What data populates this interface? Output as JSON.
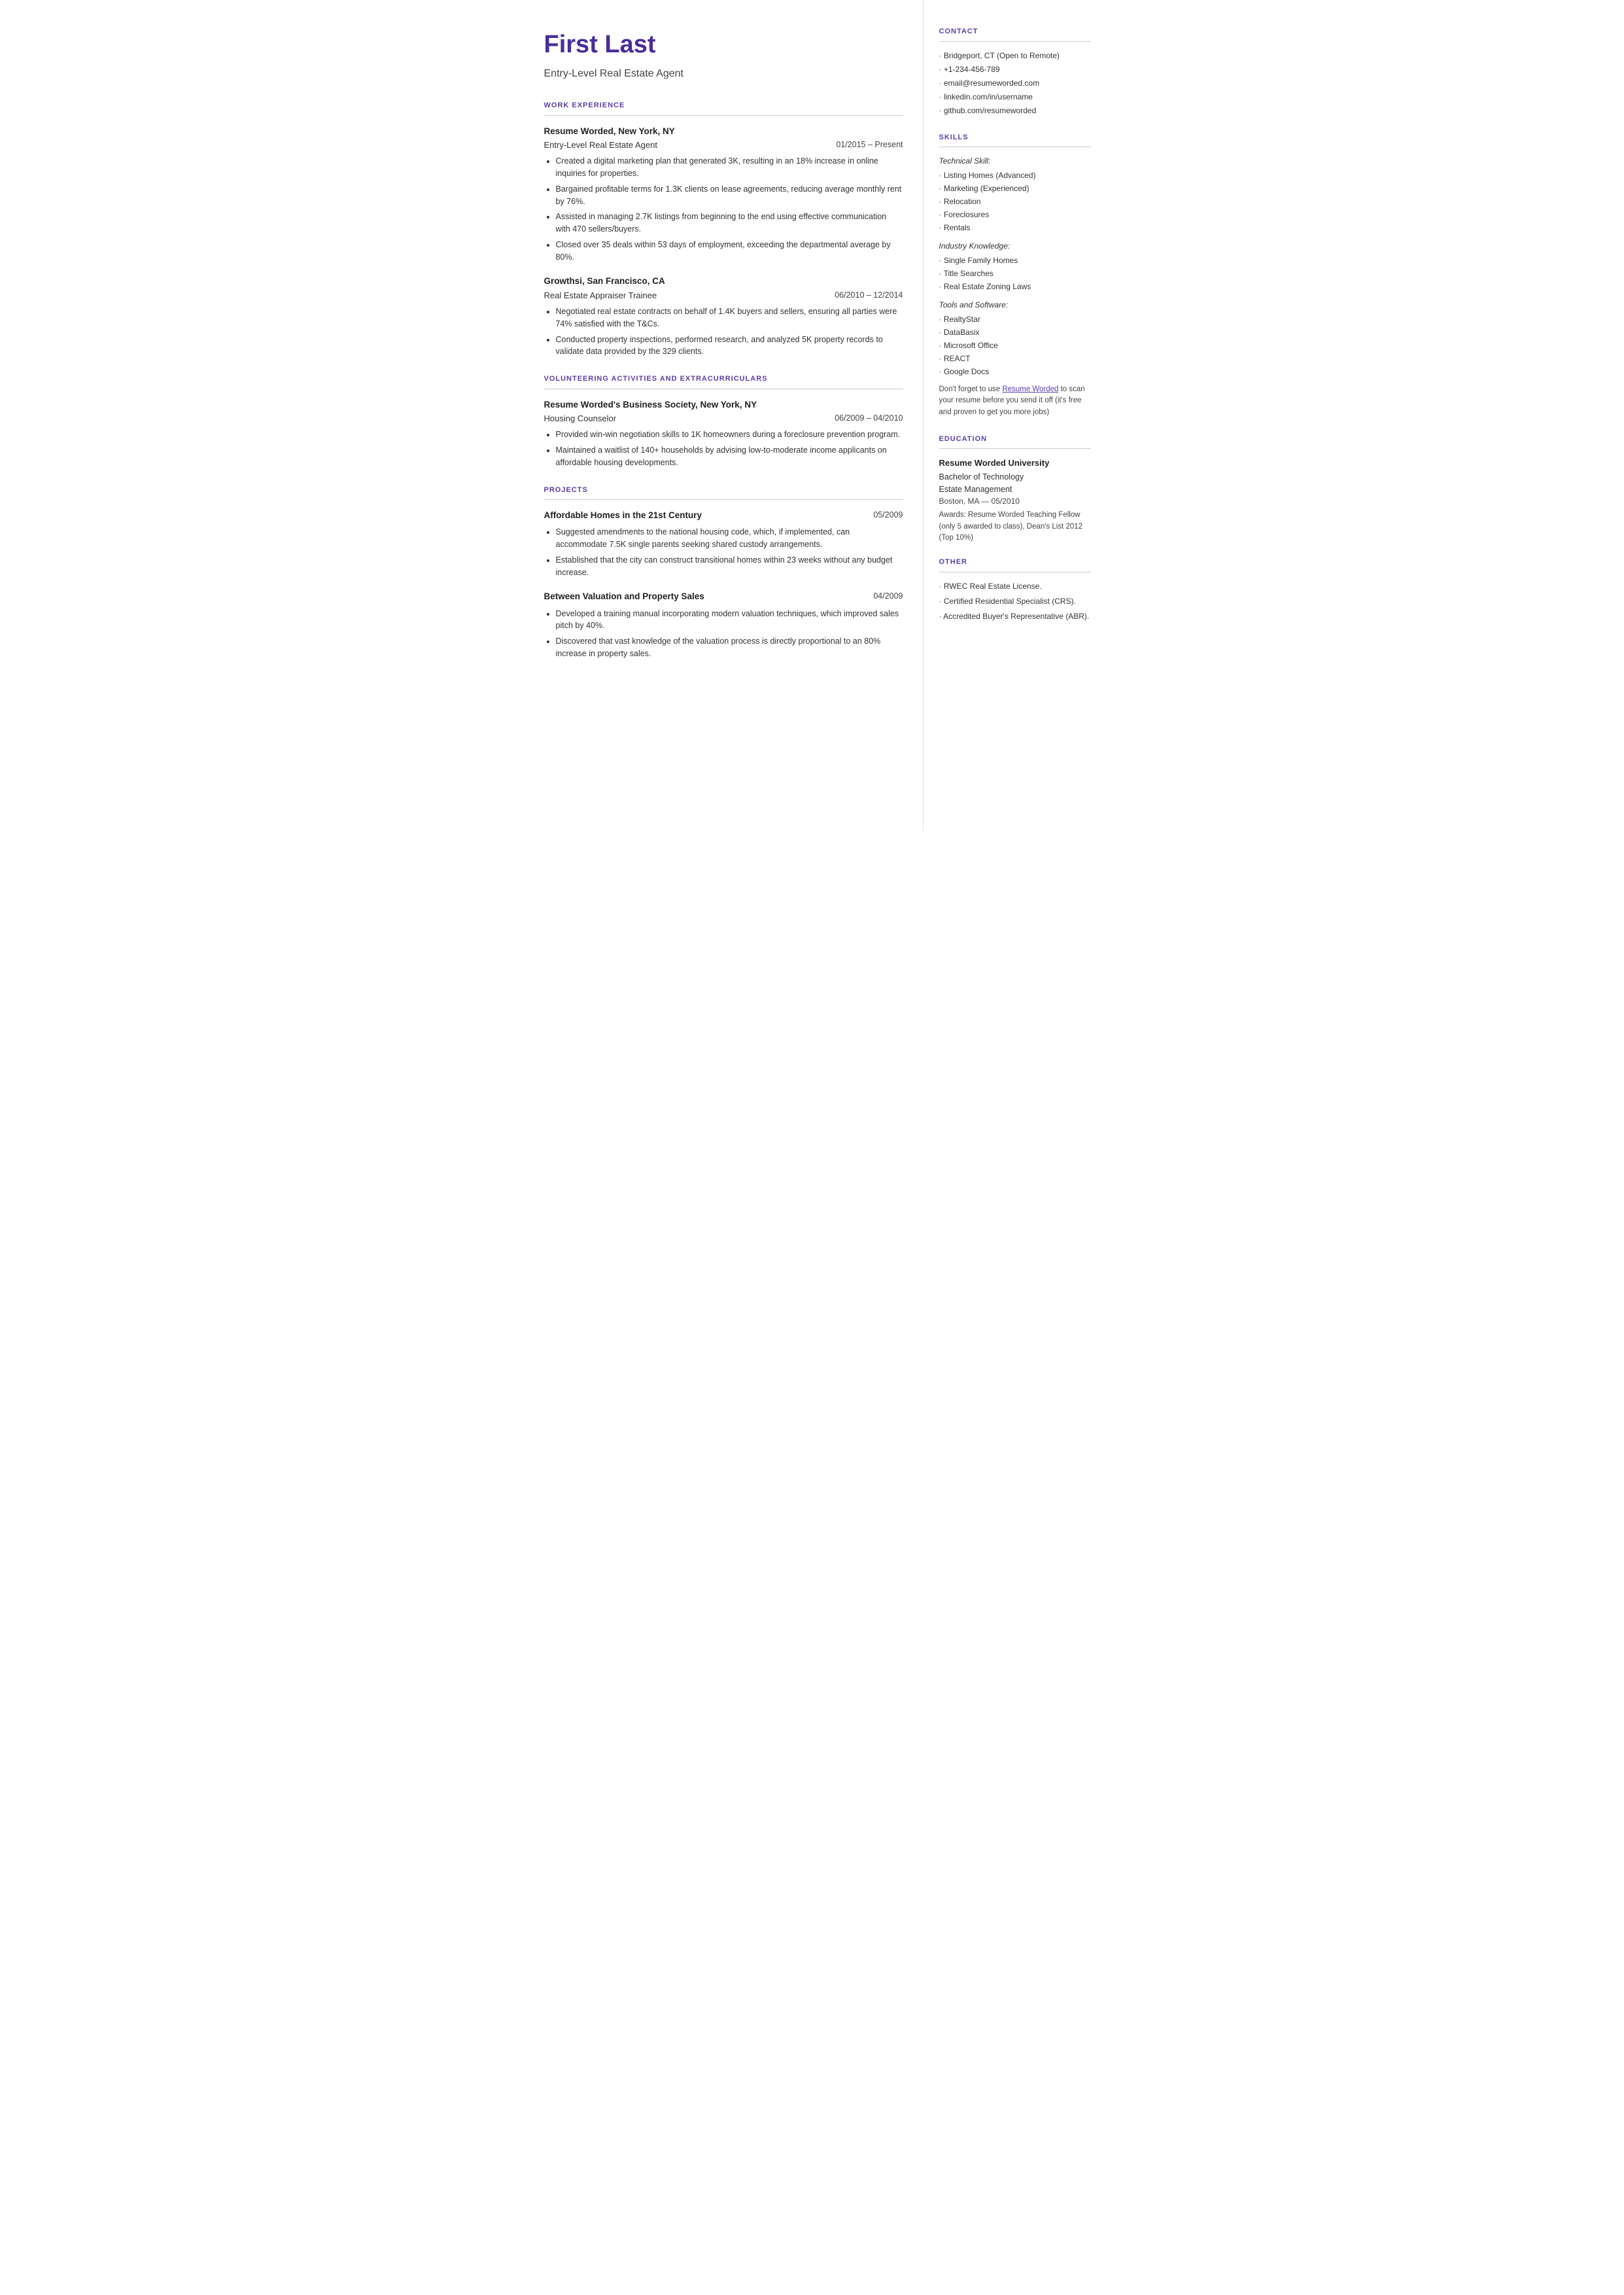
{
  "header": {
    "name": "First Last",
    "title": "Entry-Level Real Estate Agent"
  },
  "sections": {
    "work_experience_label": "WORK EXPERIENCE",
    "volunteering_label": "VOLUNTEERING ACTIVITIES AND EXTRACURRICULARS",
    "projects_label": "PROJECTS"
  },
  "jobs": [
    {
      "company": "Resume Worded, New York, NY",
      "role": "Entry-Level Real Estate Agent",
      "dates": "01/2015 – Present",
      "bullets": [
        "Created a digital marketing plan that generated 3K, resulting in an 18% increase in online inquiries for properties.",
        "Bargained profitable terms for 1.3K clients on lease agreements, reducing average monthly rent by 76%.",
        "Assisted in managing 2.7K listings from beginning to the end using effective communication with 470 sellers/buyers.",
        "Closed over 35 deals within 53 days of employment, exceeding the departmental average by 80%."
      ]
    },
    {
      "company": "Growthsi, San Francisco, CA",
      "role": "Real Estate Appraiser Trainee",
      "dates": "06/2010 – 12/2014",
      "bullets": [
        "Negotiated real estate contracts on behalf of 1.4K buyers and sellers, ensuring all parties were 74% satisfied with the T&Cs.",
        "Conducted property inspections, performed research, and analyzed 5K property records to validate data provided by the 329 clients."
      ]
    }
  ],
  "volunteering": [
    {
      "company": "Resume Worded's Business Society, New York, NY",
      "role": "Housing Counselor",
      "dates": "06/2009 – 04/2010",
      "bullets": [
        "Provided win-win negotiation skills to 1K homeowners during a foreclosure prevention program.",
        "Maintained a waitlist of 140+ households by advising low-to-moderate income applicants on affordable housing developments."
      ]
    }
  ],
  "projects": [
    {
      "title": "Affordable Homes in the 21st Century",
      "date": "05/2009",
      "bullets": [
        "Suggested amendments to the national housing code, which, if implemented, can accommodate 7.5K single parents seeking shared custody arrangements.",
        "Established that the city can construct transitional homes within 23 weeks without any budget increase."
      ]
    },
    {
      "title": "Between Valuation and Property Sales",
      "date": "04/2009",
      "bullets": [
        "Developed a training manual incorporating modern valuation techniques, which improved sales pitch by 40%.",
        "Discovered that vast knowledge of the valuation process is directly proportional to an 80% increase in property sales."
      ]
    }
  ],
  "contact": {
    "label": "CONTACT",
    "items": [
      "Bridgeport, CT (Open to Remote)",
      "+1-234-456-789",
      "email@resumeworded.com",
      "linkedin.com/in/username",
      "github.com/resumeworded"
    ]
  },
  "skills": {
    "label": "SKILLS",
    "technical_label": "Technical Skill:",
    "technical_items": [
      "Listing Homes (Advanced)",
      "Marketing (Experienced)",
      "Relocation",
      "Foreclosures",
      "Rentals"
    ],
    "industry_label": "Industry Knowledge:",
    "industry_items": [
      "Single Family Homes",
      "Title Searches",
      "Real Estate Zoning Laws"
    ],
    "tools_label": "Tools and Software:",
    "tools_items": [
      "RealtyStar",
      "DataBasix",
      "Microsoft Office",
      "REACT",
      "Google Docs"
    ],
    "promo_text": "Don't forget to use ",
    "promo_link_text": "Resume Worded",
    "promo_text2": " to scan your resume before you send it off (it's free and proven to get you more jobs)"
  },
  "education": {
    "label": "EDUCATION",
    "school": "Resume Worded University",
    "degree": "Bachelor of Technology",
    "field": "Estate Management",
    "location": "Boston, MA — 05/2010",
    "awards": "Awards: Resume Worded Teaching Fellow (only 5 awarded to class), Dean's List 2012 (Top 10%)"
  },
  "other": {
    "label": "OTHER",
    "items": [
      "RWEC Real Estate License.",
      "Certified Residential Specialist (CRS).",
      "Accredited Buyer's Representative (ABR)."
    ]
  }
}
